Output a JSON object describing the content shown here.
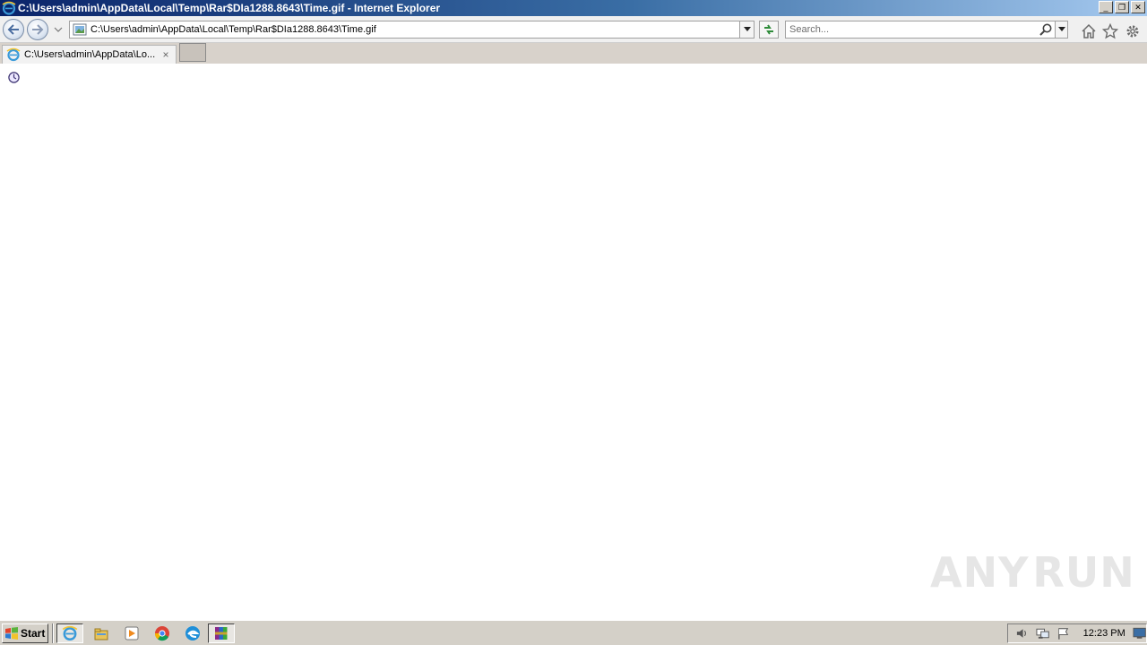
{
  "window": {
    "title": "C:\\Users\\admin\\AppData\\Local\\Temp\\Rar$DIa1288.8643\\Time.gif - Internet Explorer",
    "controls": {
      "minimize": "_",
      "restore": "❐",
      "close": "✕"
    }
  },
  "navbar": {
    "address_url": "C:\\Users\\admin\\AppData\\Local\\Temp\\Rar$DIa1288.8643\\Time.gif",
    "search_placeholder": "Search..."
  },
  "tabs": [
    {
      "label": "C:\\Users\\admin\\AppData\\Lo...",
      "close": "×",
      "active": true
    }
  ],
  "content": {
    "image": "clock-icon"
  },
  "watermark": {
    "left": "ANY",
    "right": "RUN"
  },
  "taskbar": {
    "start_label": "Start",
    "pinned": [
      "internet-explorer-icon",
      "file-explorer-icon",
      "media-player-icon",
      "chrome-icon",
      "edge-icon",
      "winrar-icon"
    ],
    "clock": "12:23 PM"
  },
  "colors": {
    "titlebar_start": "#0a246a",
    "titlebar_end": "#a6caf0",
    "chrome_bg": "#f0f0f0",
    "tabbar_bg": "#d8d2cb",
    "taskbar_bg": "#d4d0c8"
  }
}
